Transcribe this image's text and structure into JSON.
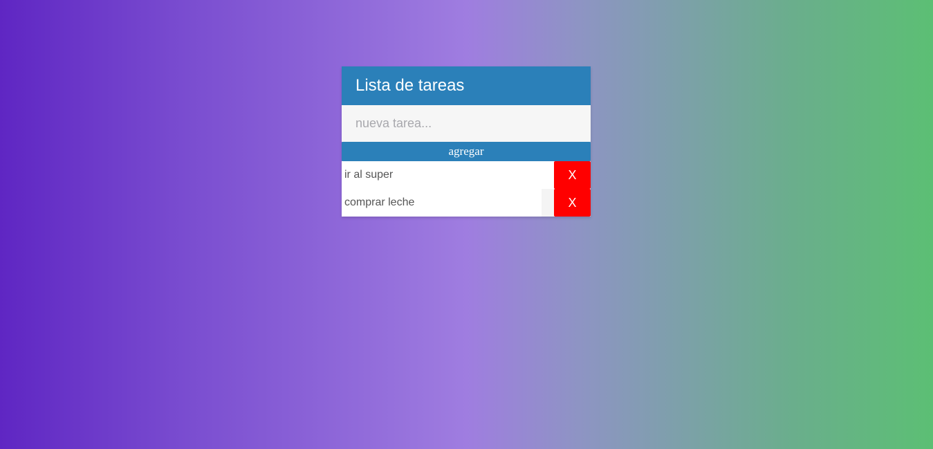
{
  "app": {
    "title": "Lista de tareas"
  },
  "input": {
    "placeholder": "nueva tarea...",
    "value": ""
  },
  "add_button": {
    "label": "agregar"
  },
  "tasks": [
    {
      "text": "ir al super",
      "delete_label": "X"
    },
    {
      "text": "comprar leche",
      "delete_label": "X"
    }
  ],
  "colors": {
    "header": "#2b80b9",
    "button": "#2b80b9",
    "delete": "#ff0000",
    "gradient_start": "#5f26c3",
    "gradient_mid": "#9f7de0",
    "gradient_end": "#5cbf74"
  }
}
